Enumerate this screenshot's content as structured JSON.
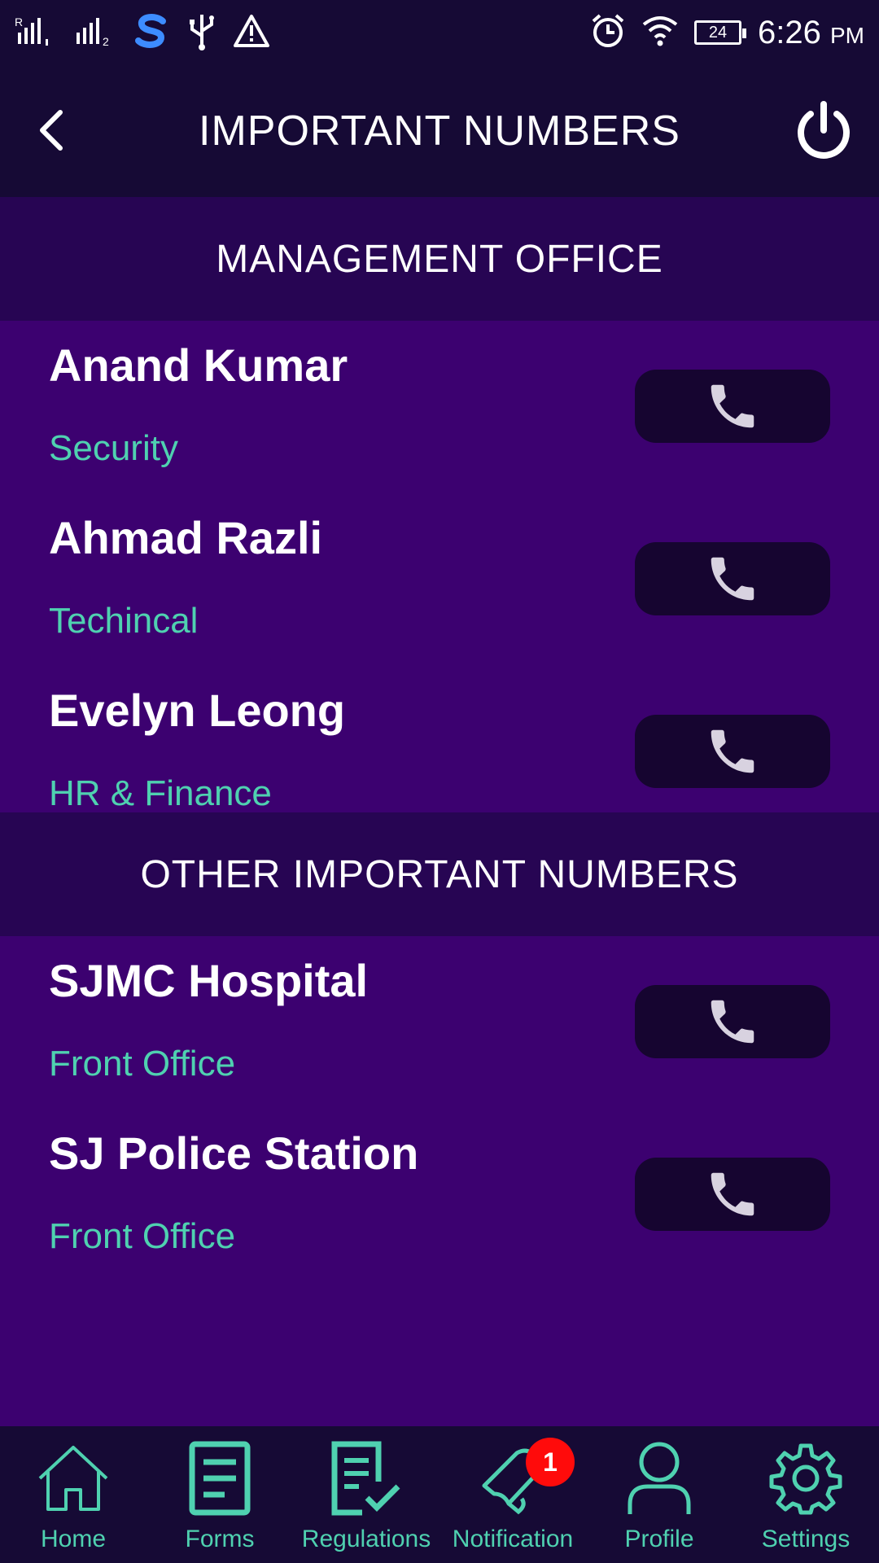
{
  "status_bar": {
    "time": "6:26",
    "ampm": "PM",
    "battery": "24",
    "icons": [
      "signal-r-icon",
      "signal-2-icon",
      "s-app-icon",
      "usb-icon",
      "warning-icon",
      "alarm-icon",
      "wifi-icon",
      "battery-icon"
    ]
  },
  "header": {
    "title": "IMPORTANT NUMBERS",
    "back_icon": "chevron-left-icon",
    "power_icon": "power-icon"
  },
  "sections": [
    {
      "title": "MANAGEMENT OFFICE",
      "contacts": [
        {
          "name": "Anand Kumar",
          "dept": "Security"
        },
        {
          "name": "Ahmad Razli",
          "dept": "Techincal"
        },
        {
          "name": "Evelyn Leong",
          "dept": "HR & Finance"
        }
      ]
    },
    {
      "title": "OTHER IMPORTANT NUMBERS",
      "contacts": [
        {
          "name": "SJMC Hospital",
          "dept": "Front Office"
        },
        {
          "name": "SJ Police Station",
          "dept": "Front Office"
        }
      ]
    }
  ],
  "nav": {
    "items": [
      {
        "label": "Home",
        "icon": "home-icon"
      },
      {
        "label": "Forms",
        "icon": "forms-icon"
      },
      {
        "label": "Regulations",
        "icon": "regulations-icon"
      },
      {
        "label": "Notification",
        "icon": "bell-icon",
        "badge": "1"
      },
      {
        "label": "Profile",
        "icon": "profile-icon"
      },
      {
        "label": "Settings",
        "icon": "settings-icon"
      }
    ]
  },
  "colors": {
    "background": "#3c0170",
    "bar": "#160a35",
    "section": "#270553",
    "accent": "#4fd1b0",
    "call_button": "#160530",
    "badge": "#ff0b0b"
  }
}
